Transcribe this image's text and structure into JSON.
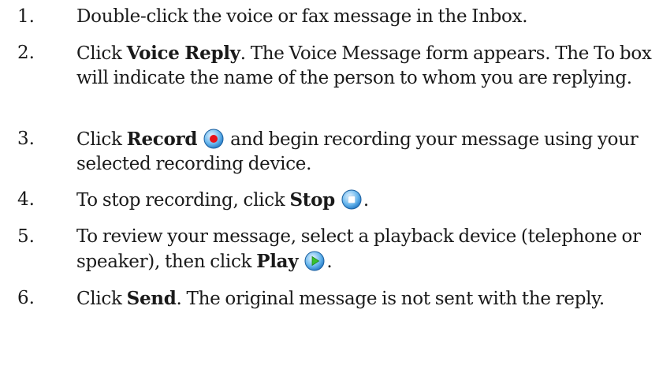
{
  "steps": [
    {
      "num": "1.",
      "parts": [
        {
          "text": "Double-click the voice or fax message in the Inbox."
        }
      ]
    },
    {
      "num": "2.",
      "parts": [
        {
          "text": "Click "
        },
        {
          "bold": "Voice Reply"
        },
        {
          "text": ". The Voice Message form appears. The To box will indicate the name of the person to whom you are replying."
        }
      ]
    },
    {
      "num": "3.",
      "parts": [
        {
          "text": "Click "
        },
        {
          "bold": "Record"
        },
        {
          "text": " "
        },
        {
          "icon": "record-icon"
        },
        {
          "text": " and begin recording your message using your selected recording device."
        }
      ]
    },
    {
      "num": "4.",
      "parts": [
        {
          "text": "To stop recording, click "
        },
        {
          "bold": "Stop"
        },
        {
          "text": " "
        },
        {
          "icon": "stop-icon"
        },
        {
          "text": "."
        }
      ]
    },
    {
      "num": "5.",
      "parts": [
        {
          "text": "To review your message, select a playback device (telephone or speaker), then click "
        },
        {
          "bold": "Play"
        },
        {
          "text": " "
        },
        {
          "icon": "play-icon"
        },
        {
          "text": "."
        }
      ]
    },
    {
      "num": "6.",
      "parts": [
        {
          "text": "Click "
        },
        {
          "bold": "Send"
        },
        {
          "text": ". The original message is not sent with the reply."
        }
      ]
    }
  ]
}
